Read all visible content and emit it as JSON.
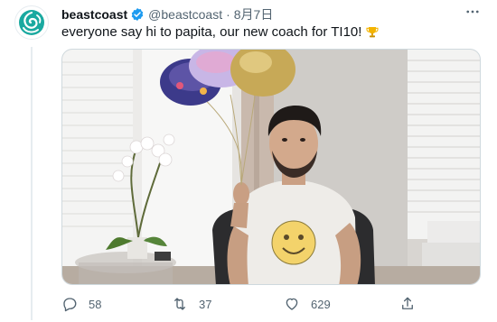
{
  "tweet": {
    "author_name": "beastcoast",
    "handle": "@beastcoast",
    "separator": "·",
    "date": "8月7日",
    "text": "everyone say hi to papita, our new coach for TI10!",
    "trophy_icon": "trophy-icon",
    "verified_icon": "verified-badge-icon",
    "more_icon": "more-options-icon"
  },
  "actions": {
    "reply_count": "58",
    "retweet_count": "37",
    "like_count": "629",
    "reply_icon": "reply-icon",
    "retweet_icon": "retweet-icon",
    "like_icon": "heart-icon",
    "share_icon": "share-icon"
  },
  "colors": {
    "text_primary": "#0f1419",
    "text_secondary": "#536471",
    "verified_blue": "#1d9bf0",
    "brand_teal": "#1aa9a0",
    "border": "#cfd9de"
  }
}
